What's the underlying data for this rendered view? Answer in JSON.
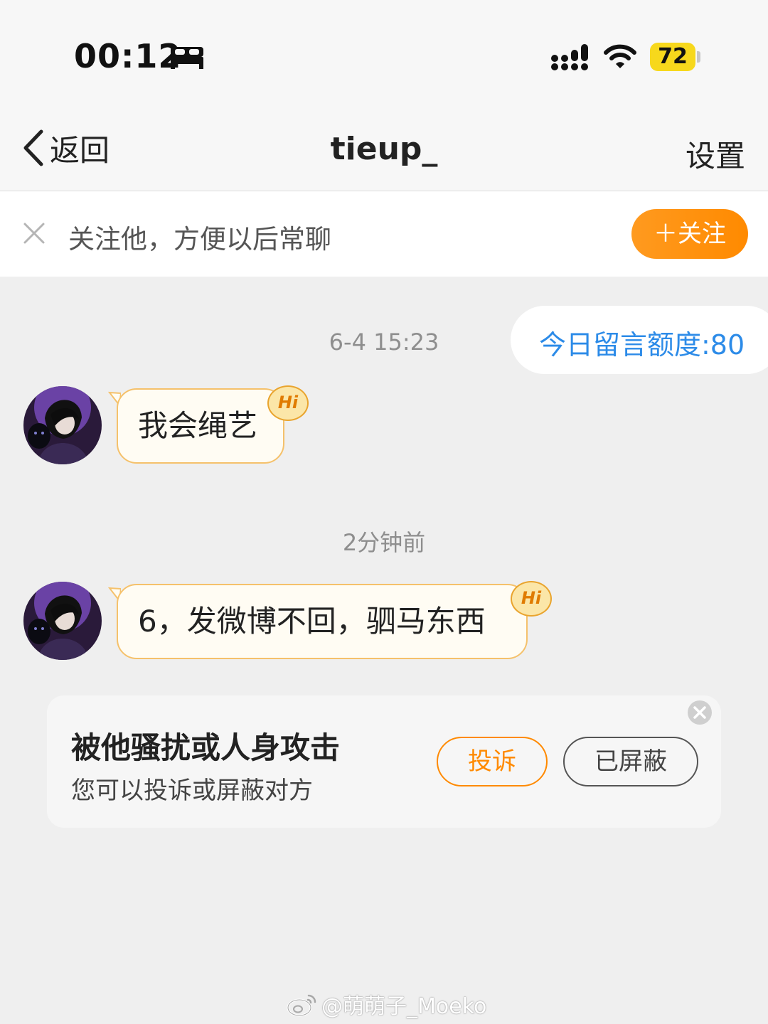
{
  "status_bar": {
    "time": "00:12",
    "battery": "72",
    "icons": [
      "bed-icon",
      "signal-icon",
      "wifi-icon",
      "battery-icon"
    ]
  },
  "nav": {
    "back_label": "返回",
    "title": "tieup_",
    "settings_label": "设置"
  },
  "follow_banner": {
    "text": "关注他，方便以后常聊",
    "button_label": "＋关注"
  },
  "quota": {
    "text": "今日留言额度:80",
    "color": "#2c8be8"
  },
  "messages": [
    {
      "timestamp": "6-4 15:23",
      "text": "我会绳艺",
      "badge": "Hi"
    },
    {
      "timestamp": "2分钟前",
      "text": "6，发微博不回，驷马东西",
      "badge": "Hi"
    }
  ],
  "report_card": {
    "title": "被他骚扰或人身攻击",
    "subtitle": "您可以投诉或屏蔽对方",
    "report_label": "投诉",
    "blocked_label": "已屏蔽"
  },
  "watermark": {
    "text": "@萌萌子_Moeko"
  },
  "colors": {
    "accent": "#ff8a00",
    "bubble_border": "#f5c16b",
    "link_blue": "#2c8be8"
  }
}
